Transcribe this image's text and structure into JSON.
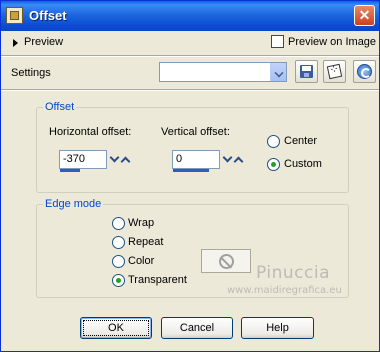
{
  "window": {
    "title": "Offset",
    "close_glyph": "✕"
  },
  "preview": {
    "label": "Preview",
    "preview_on_image_label": "Preview on Image",
    "preview_on_image_checked": false
  },
  "settings": {
    "label": "Settings",
    "combo_value": ""
  },
  "toolbar_icons": [
    "save-icon",
    "randomize-icon",
    "reset-icon"
  ],
  "offset_group": {
    "title": "Offset",
    "horizontal_label": "Horizontal offset:",
    "horizontal_value": "-370",
    "vertical_label": "Vertical offset:",
    "vertical_value": "0",
    "center_label": "Center",
    "custom_label": "Custom",
    "selected": "Custom"
  },
  "edge_group": {
    "title": "Edge mode",
    "options": [
      "Wrap",
      "Repeat",
      "Color",
      "Transparent"
    ],
    "selected": "Transparent"
  },
  "watermark": {
    "line1": "Pinuccia",
    "line2": "www.maidiregrafica.eu"
  },
  "buttons": {
    "ok": "OK",
    "cancel": "Cancel",
    "help": "Help"
  },
  "colors": {
    "title_bar": "#0A5FE6",
    "dialog_bg": "#ECE9D8",
    "group_title": "#0046D5",
    "radio_dot": "#21A121",
    "spin_bar": "#2E5CC6"
  }
}
